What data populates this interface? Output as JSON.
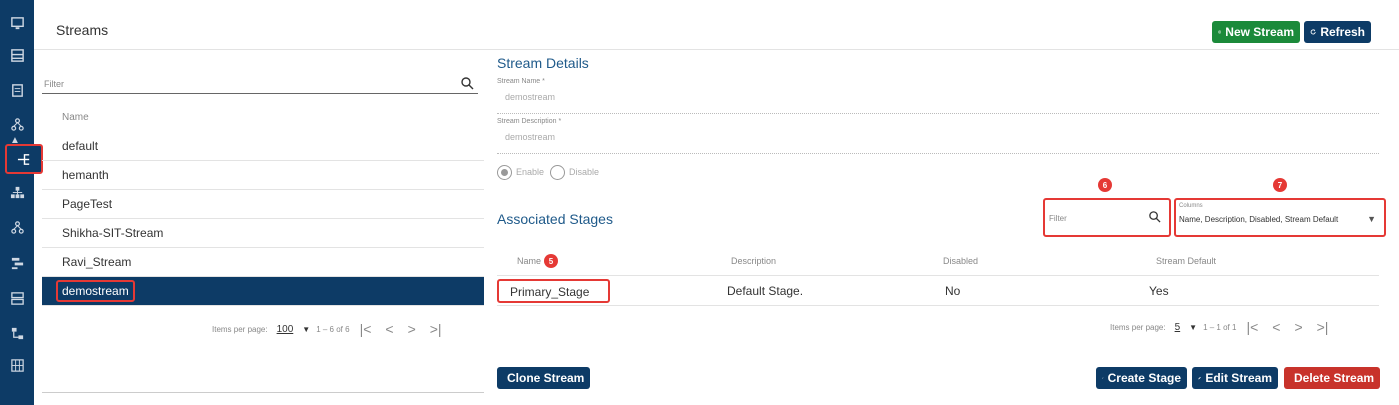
{
  "sidebar": {
    "icons": [
      "monitor-icon",
      "dashboard-icon",
      "clipboard-icon",
      "hierarchy-icon",
      "stream-icon",
      "org-tree-icon",
      "network-icon",
      "gantt-icon",
      "server-icon",
      "workflow-icon",
      "grid-icon"
    ]
  },
  "header": {
    "title": "Streams",
    "new_stream_label": "New Stream",
    "refresh_label": "Refresh"
  },
  "stream_list": {
    "filter_placeholder": "Filter",
    "column_header": "Name",
    "items": [
      "default",
      "hemanth",
      "PageTest",
      "Shikha-SIT-Stream",
      "Ravi_Stream",
      "demostream"
    ],
    "selected": "demostream",
    "pager": {
      "items_per_page_label": "Items per page:",
      "items_per_page": "100",
      "range": "1 – 6 of 6"
    }
  },
  "details": {
    "title": "Stream Details",
    "stream_name_label": "Stream Name *",
    "stream_name_value": "demostream",
    "stream_description_label": "Stream Description *",
    "stream_description_value": "demostream",
    "enable_label": "Enable",
    "disable_label": "Disable",
    "enabled": true
  },
  "stages": {
    "title": "Associated Stages",
    "filter_placeholder": "Filter",
    "columns_label": "Columns",
    "columns_value": "Name, Description, Disabled, Stream Default",
    "headers": {
      "name": "Name",
      "description": "Description",
      "disabled": "Disabled",
      "stream_default": "Stream Default"
    },
    "rows": [
      {
        "name": "Primary_Stage",
        "description": "Default Stage.",
        "disabled": "No",
        "stream_default": "Yes"
      }
    ],
    "pager": {
      "items_per_page_label": "Items per page:",
      "items_per_page": "5",
      "range": "1 – 1 of 1"
    }
  },
  "annotations": {
    "b5": "5",
    "b6": "6",
    "b7": "7"
  },
  "actions": {
    "clone_stream": "Clone Stream",
    "create_stage": "Create Stage",
    "edit_stream": "Edit Stream",
    "delete_stream": "Delete Stream"
  },
  "colors": {
    "navy": "#0d3b66",
    "green": "#1b8a3a",
    "red": "#c8332b",
    "annotation_red": "#e53935",
    "section_blue": "#1f5a8a"
  }
}
